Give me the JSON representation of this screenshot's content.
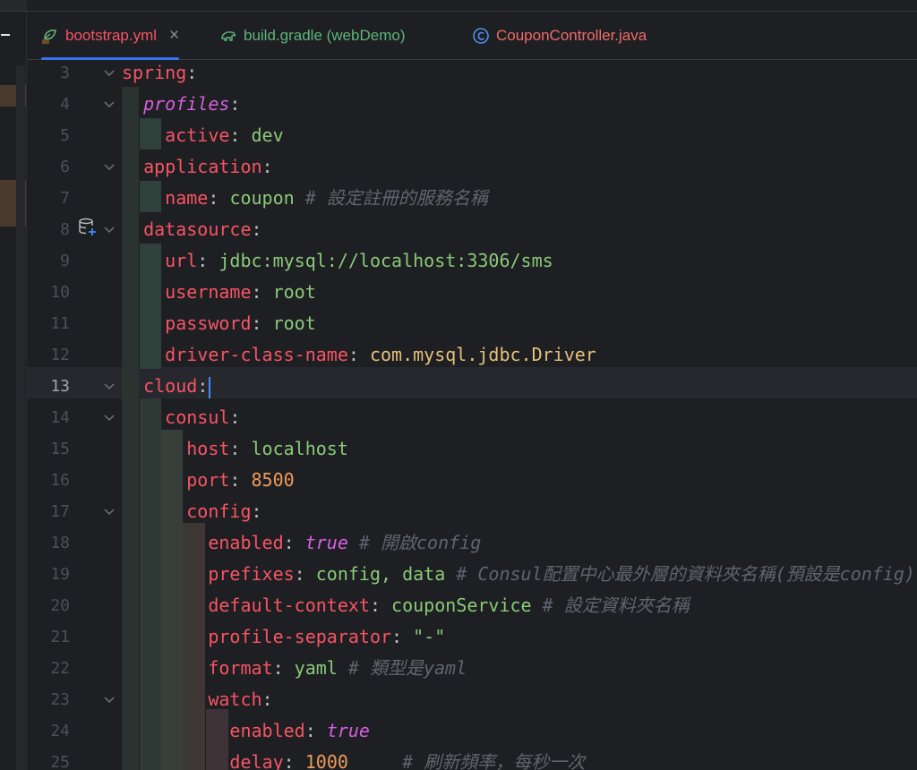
{
  "tabs": [
    {
      "label": "bootstrap.yml",
      "icon": "yaml-file-icon",
      "color": "#f75464",
      "active": true,
      "closable": true
    },
    {
      "label": "build.gradle (webDemo)",
      "icon": "gradle-elephant-icon",
      "color": "#5fb57a",
      "active": false,
      "closable": false
    },
    {
      "label": "CouponController.java",
      "icon": "java-class-icon",
      "color": "#ef6b6b",
      "active": false,
      "closable": false
    }
  ],
  "close_glyph": "×",
  "current_line": "13",
  "lines": [
    {
      "no": "3",
      "fold": true,
      "tokens": [
        {
          "t": "spring",
          "s": "k"
        },
        {
          "t": ":",
          "s": "p"
        }
      ]
    },
    {
      "no": "4",
      "fold": true,
      "tokens": [
        {
          "t": "  "
        },
        {
          "t": "profiles",
          "s": "kp"
        },
        {
          "t": ":",
          "s": "p"
        }
      ]
    },
    {
      "no": "5",
      "fold": false,
      "tokens": [
        {
          "t": "    "
        },
        {
          "t": "active",
          "s": "k"
        },
        {
          "t": ": ",
          "s": "p"
        },
        {
          "t": "dev",
          "s": "v"
        }
      ]
    },
    {
      "no": "6",
      "fold": true,
      "tokens": [
        {
          "t": "  "
        },
        {
          "t": "application",
          "s": "k"
        },
        {
          "t": ":",
          "s": "p"
        }
      ]
    },
    {
      "no": "7",
      "fold": false,
      "tokens": [
        {
          "t": "    "
        },
        {
          "t": "name",
          "s": "k"
        },
        {
          "t": ": ",
          "s": "p"
        },
        {
          "t": "coupon",
          "s": "v"
        },
        {
          "t": " # 設定註冊的服務名稱",
          "s": "c"
        }
      ]
    },
    {
      "no": "8",
      "fold": true,
      "tokens": [
        {
          "t": "  "
        },
        {
          "t": "datasource",
          "s": "k"
        },
        {
          "t": ":",
          "s": "p"
        }
      ]
    },
    {
      "no": "9",
      "fold": false,
      "tokens": [
        {
          "t": "    "
        },
        {
          "t": "url",
          "s": "k"
        },
        {
          "t": ": ",
          "s": "p"
        },
        {
          "t": "jdbc:mysql://localhost:3306/sms",
          "s": "v"
        }
      ]
    },
    {
      "no": "10",
      "fold": false,
      "tokens": [
        {
          "t": "    "
        },
        {
          "t": "username",
          "s": "k"
        },
        {
          "t": ": ",
          "s": "p"
        },
        {
          "t": "root",
          "s": "v"
        }
      ]
    },
    {
      "no": "11",
      "fold": false,
      "tokens": [
        {
          "t": "    "
        },
        {
          "t": "password",
          "s": "k"
        },
        {
          "t": ": ",
          "s": "p"
        },
        {
          "t": "root",
          "s": "v"
        }
      ]
    },
    {
      "no": "12",
      "fold": false,
      "tokens": [
        {
          "t": "    "
        },
        {
          "t": "driver-class-name",
          "s": "k"
        },
        {
          "t": ": ",
          "s": "p"
        },
        {
          "t": "com.mysql.jdbc.Driver",
          "s": "cls"
        }
      ]
    },
    {
      "no": "13",
      "fold": true,
      "tokens": [
        {
          "t": "  "
        },
        {
          "t": "cloud",
          "s": "k"
        },
        {
          "t": ":",
          "s": "p"
        }
      ],
      "caret": true
    },
    {
      "no": "14",
      "fold": true,
      "tokens": [
        {
          "t": "    "
        },
        {
          "t": "consul",
          "s": "k"
        },
        {
          "t": ":",
          "s": "p"
        }
      ]
    },
    {
      "no": "15",
      "fold": false,
      "tokens": [
        {
          "t": "      "
        },
        {
          "t": "host",
          "s": "k"
        },
        {
          "t": ": ",
          "s": "p"
        },
        {
          "t": "localhost",
          "s": "v"
        }
      ]
    },
    {
      "no": "16",
      "fold": false,
      "tokens": [
        {
          "t": "      "
        },
        {
          "t": "port",
          "s": "k"
        },
        {
          "t": ": ",
          "s": "p"
        },
        {
          "t": "8500",
          "s": "n"
        }
      ]
    },
    {
      "no": "17",
      "fold": true,
      "tokens": [
        {
          "t": "      "
        },
        {
          "t": "config",
          "s": "k"
        },
        {
          "t": ":",
          "s": "p"
        }
      ]
    },
    {
      "no": "18",
      "fold": false,
      "tokens": [
        {
          "t": "        "
        },
        {
          "t": "enabled",
          "s": "k"
        },
        {
          "t": ": ",
          "s": "p"
        },
        {
          "t": "true",
          "s": "b"
        },
        {
          "t": " # 開啟config",
          "s": "c"
        }
      ]
    },
    {
      "no": "19",
      "fold": false,
      "tokens": [
        {
          "t": "        "
        },
        {
          "t": "prefixes",
          "s": "k"
        },
        {
          "t": ": ",
          "s": "p"
        },
        {
          "t": "config, data",
          "s": "v"
        },
        {
          "t": " # Consul配置中心最外層的資料夾名稱(預設是config)",
          "s": "c"
        }
      ]
    },
    {
      "no": "20",
      "fold": false,
      "tokens": [
        {
          "t": "        "
        },
        {
          "t": "default-context",
          "s": "k"
        },
        {
          "t": ": ",
          "s": "p"
        },
        {
          "t": "couponService",
          "s": "v"
        },
        {
          "t": " # 設定資料夾名稱",
          "s": "c"
        }
      ]
    },
    {
      "no": "21",
      "fold": false,
      "tokens": [
        {
          "t": "        "
        },
        {
          "t": "profile-separator",
          "s": "k"
        },
        {
          "t": ": ",
          "s": "p"
        },
        {
          "t": "\"-\"",
          "s": "v"
        }
      ]
    },
    {
      "no": "22",
      "fold": false,
      "tokens": [
        {
          "t": "        "
        },
        {
          "t": "format",
          "s": "k"
        },
        {
          "t": ": ",
          "s": "p"
        },
        {
          "t": "yaml",
          "s": "v"
        },
        {
          "t": " # 類型是yaml",
          "s": "c"
        }
      ]
    },
    {
      "no": "23",
      "fold": true,
      "tokens": [
        {
          "t": "        "
        },
        {
          "t": "watch",
          "s": "k"
        },
        {
          "t": ":",
          "s": "p"
        }
      ]
    },
    {
      "no": "24",
      "fold": false,
      "tokens": [
        {
          "t": "          "
        },
        {
          "t": "enabled",
          "s": "k"
        },
        {
          "t": ": ",
          "s": "p"
        },
        {
          "t": "true",
          "s": "b"
        }
      ]
    },
    {
      "no": "25",
      "fold": false,
      "tokens": [
        {
          "t": "          "
        },
        {
          "t": "delay",
          "s": "k"
        },
        {
          "t": ": ",
          "s": "p"
        },
        {
          "t": "1000",
          "s": "n"
        },
        {
          "t": "     # 刷新頻率，每秒一次",
          "s": "c"
        }
      ]
    }
  ],
  "gutter_icon": "database-add-icon",
  "colors": {
    "background": "#1e1f22",
    "key": "#f75464",
    "value": "#89ca78",
    "number": "#ef9a5a",
    "boolean": "#d55fde",
    "comment": "#5f6570",
    "accent": "#3574f0"
  }
}
